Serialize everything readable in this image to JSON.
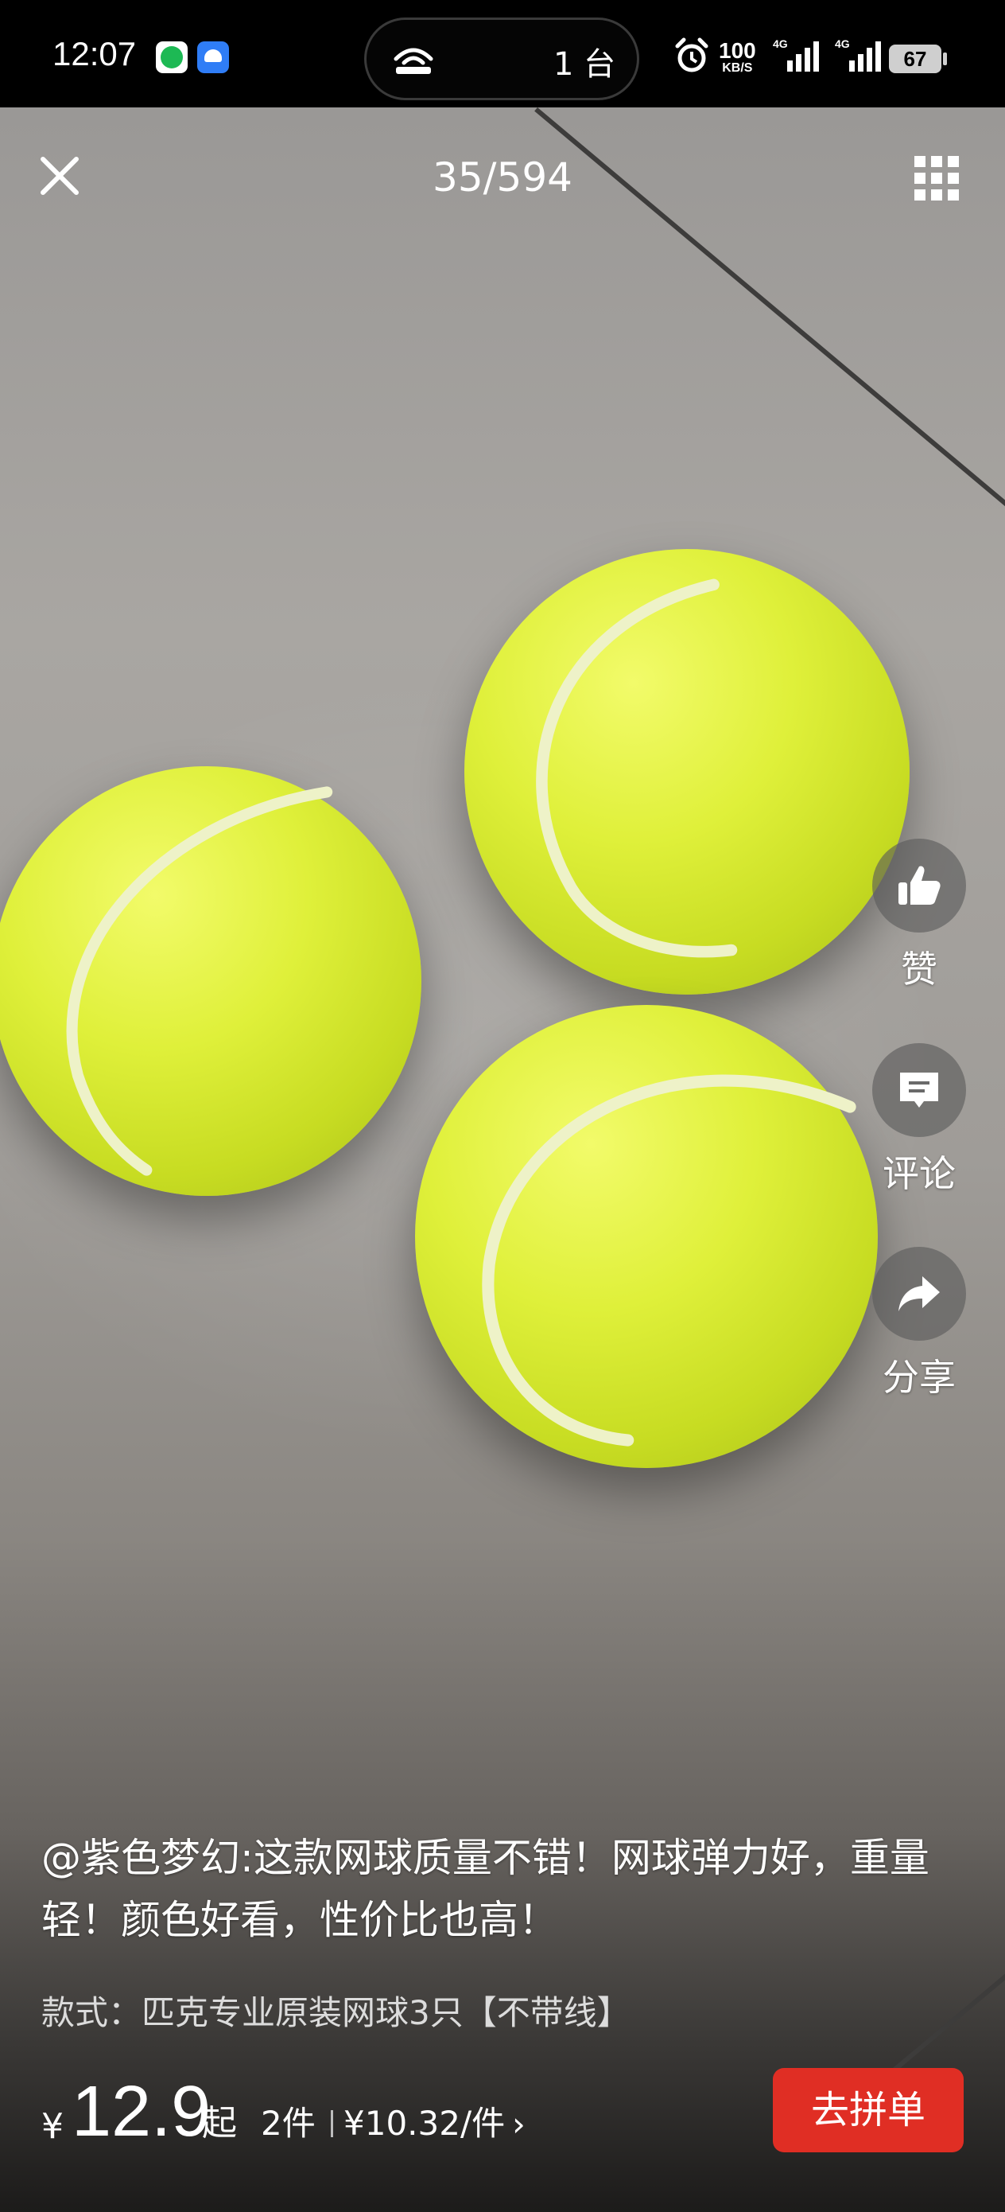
{
  "status_bar": {
    "time": "12:07",
    "app_icons": [
      "spotify-icon",
      "android-app-icon"
    ],
    "island_text": "1 台",
    "net_speed_value": "100",
    "net_speed_unit": "KB/S",
    "signal_labels": [
      "4G",
      "4G"
    ],
    "battery_level": "67"
  },
  "viewer": {
    "counter": "35/594",
    "close_icon": "close-icon",
    "grid_icon": "grid-icon"
  },
  "actions": {
    "like_label": "赞",
    "comment_label": "评论",
    "share_label": "分享"
  },
  "review": {
    "caption": "@紫色梦幻:这款网球质量不错！网球弹力好，重量轻！颜色好看，性价比也高！",
    "variant": "款式：匹克专业原装网球3只【不带线】"
  },
  "purchase": {
    "currency": "¥",
    "price": "12.9",
    "price_suffix": "起",
    "quantity": "2件",
    "unit_price": "¥10.32/件",
    "chevron": "›",
    "buy_label": "去拼单",
    "buy_color": "#e02e24"
  }
}
